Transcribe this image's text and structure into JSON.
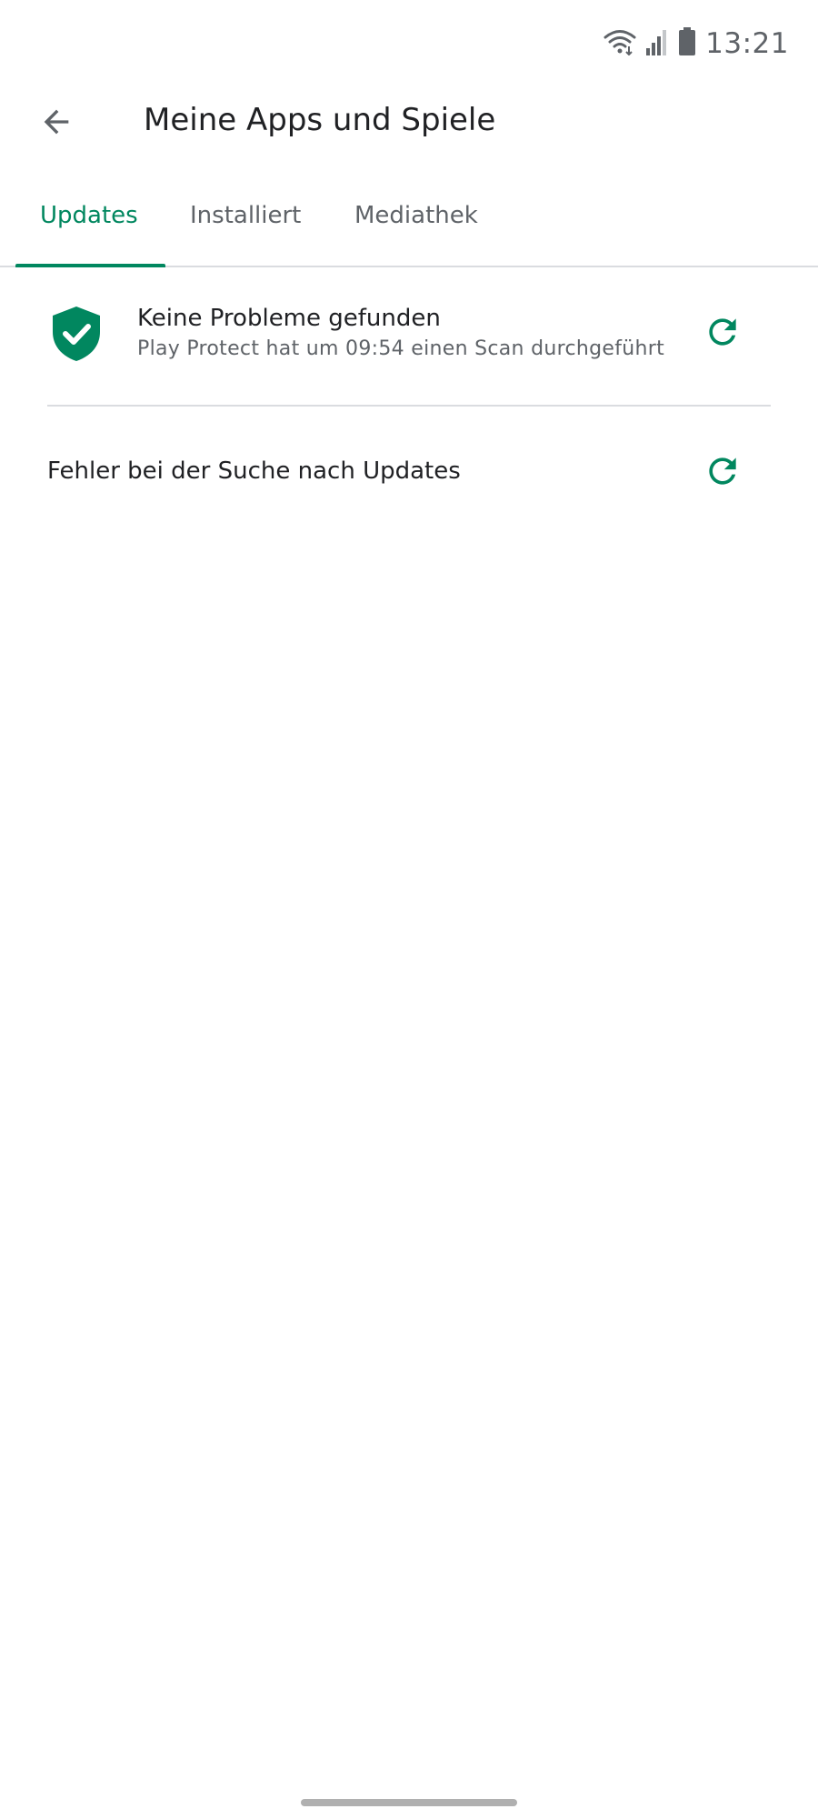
{
  "status_bar": {
    "time": "13:21",
    "icons": [
      "wifi-icon",
      "signal-icon",
      "battery-icon"
    ]
  },
  "app_bar": {
    "back_icon": "arrow-back-icon",
    "title": "Meine Apps und Spiele"
  },
  "tabs": [
    {
      "label": "Updates",
      "active": true
    },
    {
      "label": "Installiert",
      "active": false
    },
    {
      "label": "Mediathek",
      "active": false
    }
  ],
  "play_protect": {
    "icon": "shield-check-icon",
    "title": "Keine Probleme gefunden",
    "subtitle": "Play Protect hat um 09:54 einen Scan durchgeführt",
    "refresh_icon": "refresh-icon"
  },
  "updates": {
    "message": "Fehler bei der Suche nach Updates",
    "refresh_icon": "refresh-icon"
  },
  "colors": {
    "accent": "#01875f",
    "text_primary": "#202124",
    "text_secondary": "#5f6368",
    "divider": "#dadce0"
  }
}
